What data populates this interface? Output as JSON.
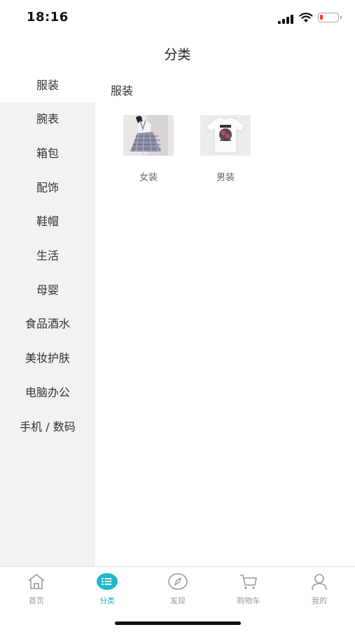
{
  "status_bar": {
    "time": "18:16"
  },
  "header": {
    "title": "分类"
  },
  "sidebar": {
    "items": [
      {
        "label": "服装",
        "active": true
      },
      {
        "label": "腕表",
        "active": false
      },
      {
        "label": "箱包",
        "active": false
      },
      {
        "label": "配饰",
        "active": false
      },
      {
        "label": "鞋帽",
        "active": false
      },
      {
        "label": "生活",
        "active": false
      },
      {
        "label": "母婴",
        "active": false
      },
      {
        "label": "食品酒水",
        "active": false
      },
      {
        "label": "美妆护肤",
        "active": false
      },
      {
        "label": "电脑办公",
        "active": false
      },
      {
        "label": "手机 / 数码",
        "active": false
      }
    ]
  },
  "main": {
    "section_title": "服装",
    "categories": [
      {
        "label": "女装",
        "icon": "womens-clothing-image"
      },
      {
        "label": "男装",
        "icon": "mens-tshirt-image"
      }
    ]
  },
  "tabbar": {
    "accent_color": "#21b8c8",
    "tabs": [
      {
        "label": "首页",
        "icon": "home-icon"
      },
      {
        "label": "分类",
        "icon": "category-list-icon",
        "active": true
      },
      {
        "label": "发现",
        "icon": "compass-icon"
      },
      {
        "label": "购物车",
        "icon": "cart-icon"
      },
      {
        "label": "我的",
        "icon": "user-icon"
      }
    ]
  }
}
